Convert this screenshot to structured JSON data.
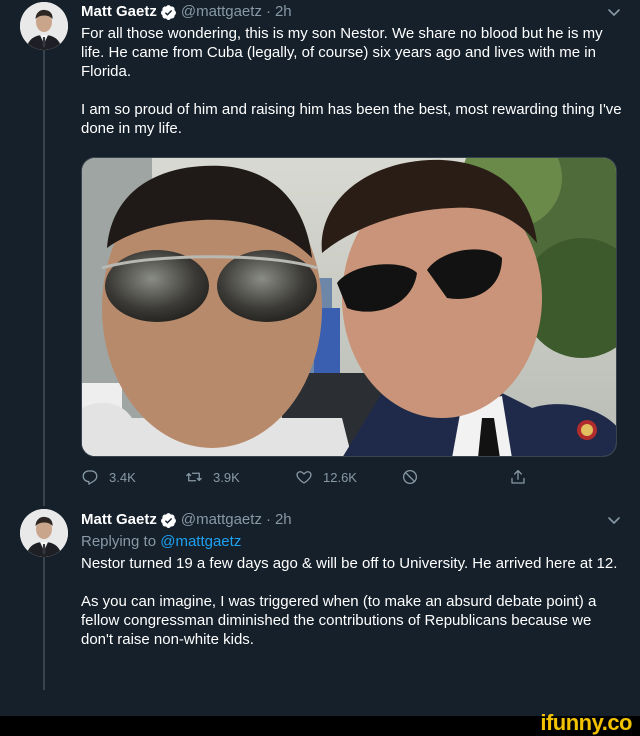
{
  "tweet1": {
    "name": "Matt Gaetz",
    "handle": "@mattgaetz",
    "separator": "·",
    "time": "2h",
    "text": "For all those wondering, this is my son Nestor.  We share no blood but he is my life. He came from Cuba (legally, of course) six years ago and lives with me in Florida.\n\nI am so proud of him and raising him has been the best, most rewarding thing I've done in my life.",
    "actions": {
      "replies": "3.4K",
      "retweets": "3.9K",
      "likes": "12.6K"
    }
  },
  "tweet2": {
    "name": "Matt Gaetz",
    "handle": "@mattgaetz",
    "separator": "·",
    "time": "2h",
    "replying_prefix": "Replying to ",
    "replying_handle": "@mattgaetz",
    "text": "Nestor turned 19 a few days ago & will be off to University. He arrived here at 12.\n\nAs you can imagine, I was triggered when (to make an absurd debate point) a fellow congressman diminished the contributions of Republicans because we don't raise non-white kids."
  },
  "watermark": "ifunny.co",
  "colors": {
    "background": "#15202b",
    "secondary_text": "#8899a6",
    "link": "#1da1f2",
    "verified": "#1da1f2",
    "watermark": "#f2c200"
  },
  "icons": [
    "verified-icon",
    "chevron-down-icon",
    "reply-icon",
    "retweet-icon",
    "like-icon",
    "block-icon",
    "share-icon"
  ]
}
